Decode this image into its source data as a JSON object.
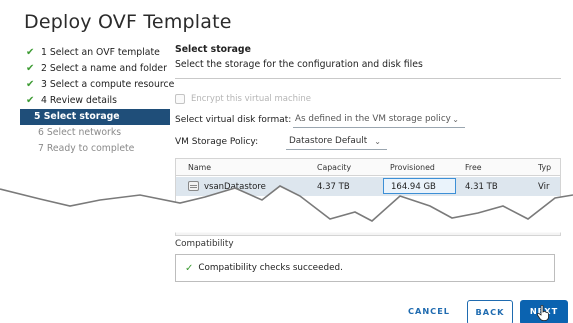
{
  "window": {
    "title": "Deploy OVF Template"
  },
  "wizard": {
    "steps": [
      {
        "label": "1 Select an OVF template",
        "state": "done"
      },
      {
        "label": "2 Select a name and folder",
        "state": "done"
      },
      {
        "label": "3 Select a compute resource",
        "state": "done"
      },
      {
        "label": "4 Review details",
        "state": "done"
      },
      {
        "label": "5 Select storage",
        "state": "active"
      },
      {
        "label": "6 Select networks",
        "state": "pending"
      },
      {
        "label": "7 Ready to complete",
        "state": "pending"
      }
    ],
    "check_glyph": "✔"
  },
  "pane": {
    "heading": "Select storage",
    "subheading": "Select the storage for the configuration and disk files",
    "encrypt_label": "Encrypt this virtual machine",
    "disk_format_label": "Select virtual disk format:",
    "disk_format_value": "As defined in the VM storage policy",
    "policy_label": "VM Storage Policy:",
    "policy_value": "Datastore Default"
  },
  "table": {
    "columns": [
      "Name",
      "Capacity",
      "Provisioned",
      "Free",
      "Typ"
    ],
    "rows": [
      {
        "name": "vsanDatastore",
        "capacity": "4.37 TB",
        "provisioned": "164.94 GB",
        "free": "4.31 TB",
        "type": "Vir"
      }
    ],
    "scroll_left": "◂",
    "scroll_right": "▸",
    "scroll_down": "⌄"
  },
  "compatibility": {
    "label": "Compatibility",
    "status": "Compatibility checks succeeded.",
    "icon": "✓"
  },
  "footer": {
    "cancel": "CANCEL",
    "back": "BACK",
    "next": "NEXT"
  },
  "colors": {
    "accent": "#0b63b0",
    "active_step": "#1f4e79",
    "success": "#3f9c35",
    "selected_row": "#dde6ee"
  }
}
